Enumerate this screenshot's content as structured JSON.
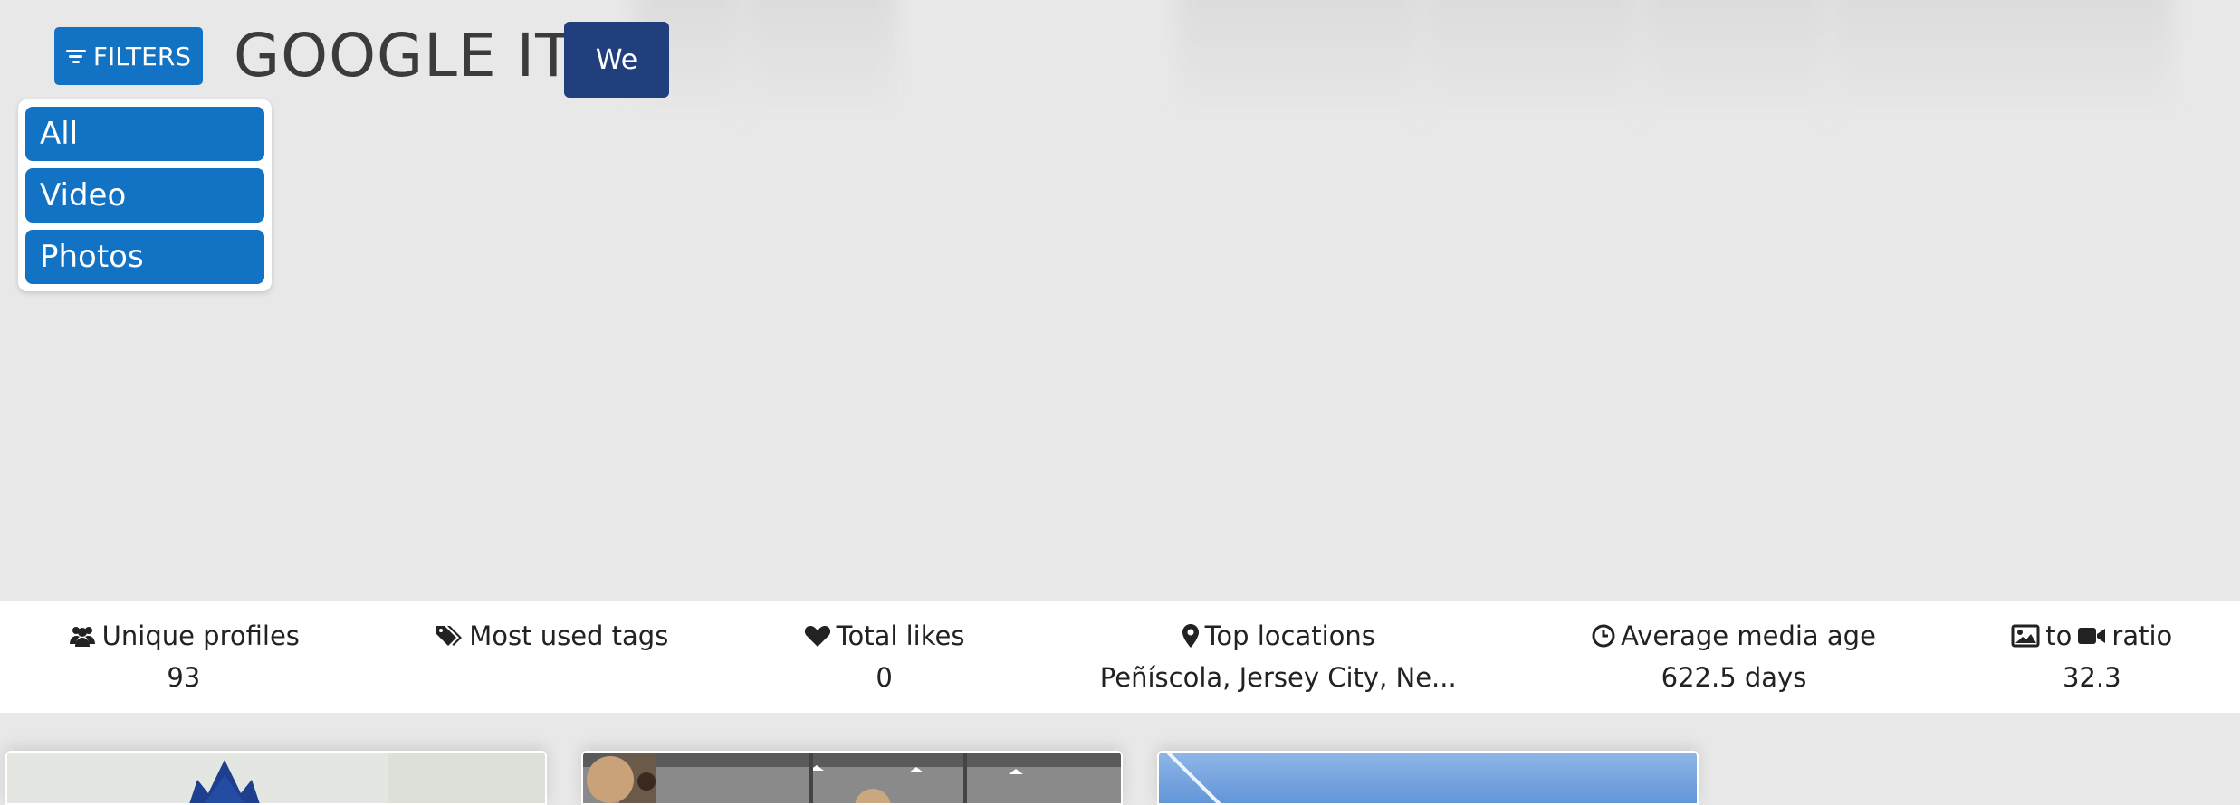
{
  "header": {
    "filters_label": "FILTERS",
    "title": "GOOGLE IT",
    "we_label": "We"
  },
  "filter_menu": {
    "options": [
      "All",
      "Video",
      "Photos"
    ]
  },
  "stats": [
    {
      "icon": "users-icon",
      "label": "Unique profiles",
      "value": "93"
    },
    {
      "icon": "tags-icon",
      "label": "Most used tags",
      "value": ""
    },
    {
      "icon": "heart-icon",
      "label": "Total likes",
      "value": "0"
    },
    {
      "icon": "map-pin-icon",
      "label": "Top locations",
      "value": "Peñíscola, Jersey City, Ne..."
    },
    {
      "icon": "clock-icon",
      "label": "Average media age",
      "value": "622.5 days"
    },
    {
      "icon": "image-icon",
      "label_mid": "to",
      "icon2": "video-icon",
      "label": "ratio",
      "value": "32.3"
    }
  ],
  "cards": [
    {
      "name": "media-card-mascot"
    },
    {
      "name": "media-card-teddy-bears"
    },
    {
      "name": "media-card-sky"
    }
  ],
  "colors": {
    "primary": "#1272c3",
    "dark_button": "#203f7c",
    "background": "#e8e8e8"
  }
}
